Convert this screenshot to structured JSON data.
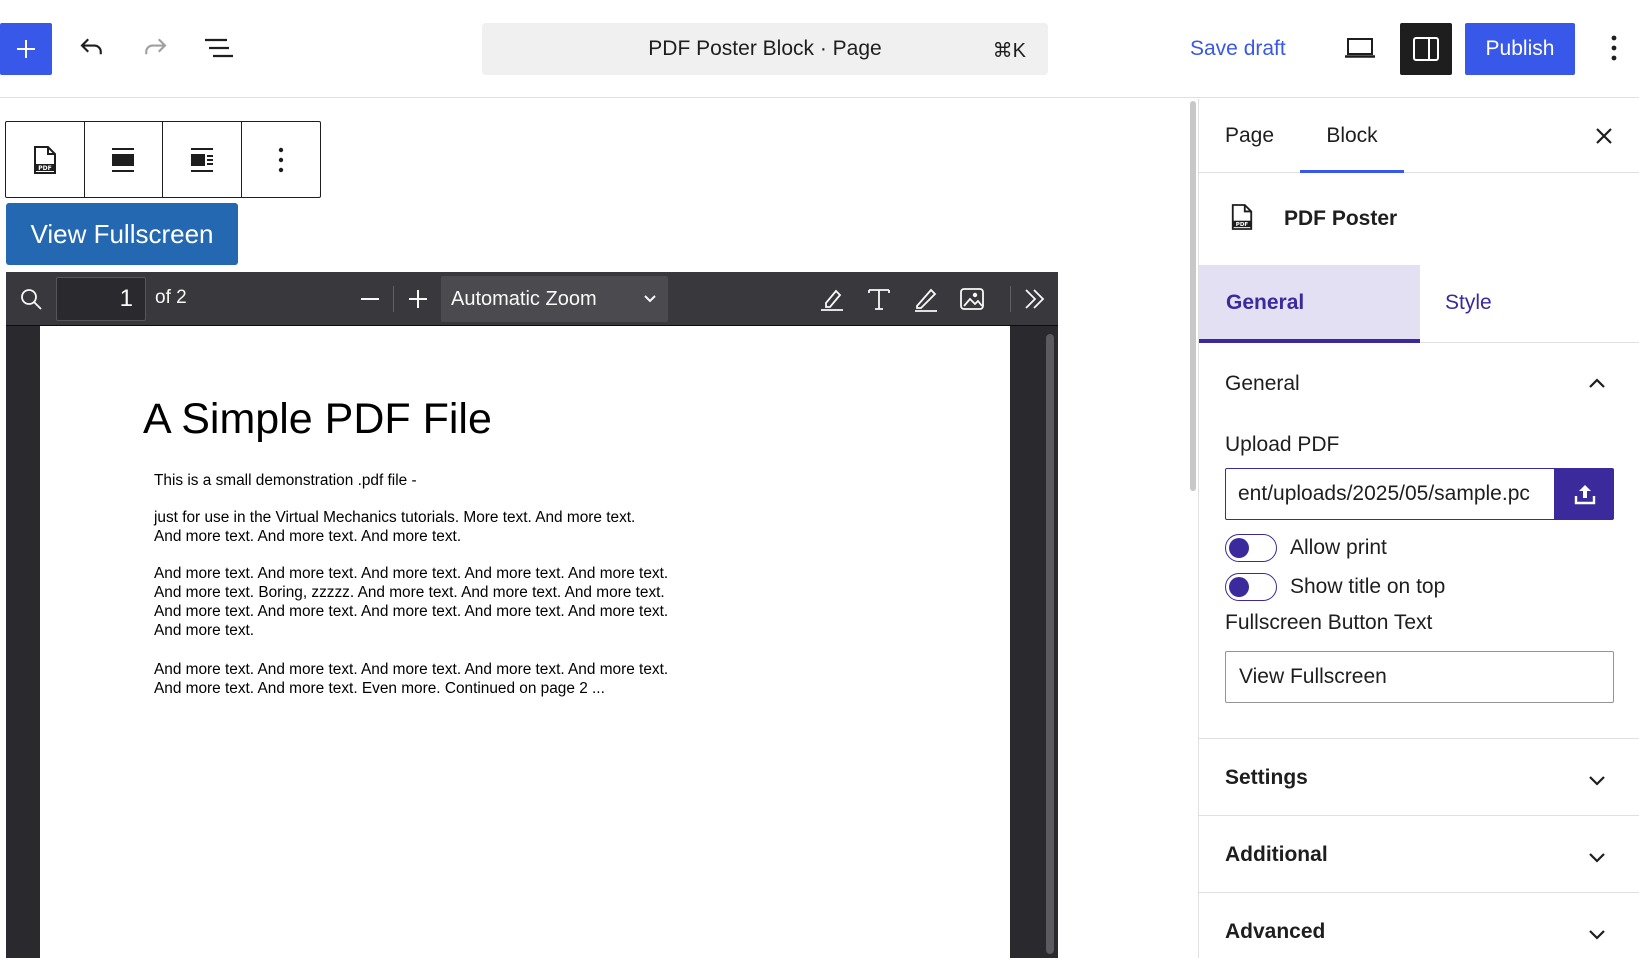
{
  "header": {
    "document_title": "PDF Poster Block · Page",
    "shortcut": "⌘K",
    "save_draft_label": "Save draft",
    "publish_label": "Publish",
    "accent_color": "#3858e9"
  },
  "editor": {
    "view_fullscreen_label": "View Fullscreen",
    "pdf_viewer": {
      "page_number": "1",
      "page_of": "of 2",
      "zoom_value": "Automatic Zoom",
      "document": {
        "title": "A Simple PDF File",
        "paragraphs": [
          "This is a small demonstration .pdf file -",
          "just for use in the Virtual Mechanics tutorials. More text. And more text. And more text. And more text. And more text.",
          "And more text. And more text. And more text. And more text. And more text. And more text. Boring, zzzzz. And more text. And more text. And more text. And more text. And more text. And more text. And more text. And more text. And more text.",
          "And more text. And more text. And more text. And more text. And more text. And more text. And more text. Even more. Continued on page 2 ..."
        ]
      }
    }
  },
  "sidebar": {
    "tabs": [
      "Page",
      "Block"
    ],
    "active_tab": "Block",
    "block_name": "PDF Poster",
    "inner_tabs": [
      "General",
      "Style"
    ],
    "active_inner_tab": "General",
    "panels": {
      "general": {
        "title": "General",
        "upload_label": "Upload PDF",
        "upload_value": "ent/uploads/2025/05/sample.pc",
        "allow_print_label": "Allow print",
        "show_title_label": "Show title on top",
        "fullscreen_text_label": "Fullscreen Button Text",
        "fullscreen_text_value": "View Fullscreen"
      },
      "settings": {
        "title": "Settings"
      },
      "additional": {
        "title": "Additional"
      },
      "advanced": {
        "title": "Advanced"
      }
    },
    "brand_color": "#3a2a9c"
  }
}
